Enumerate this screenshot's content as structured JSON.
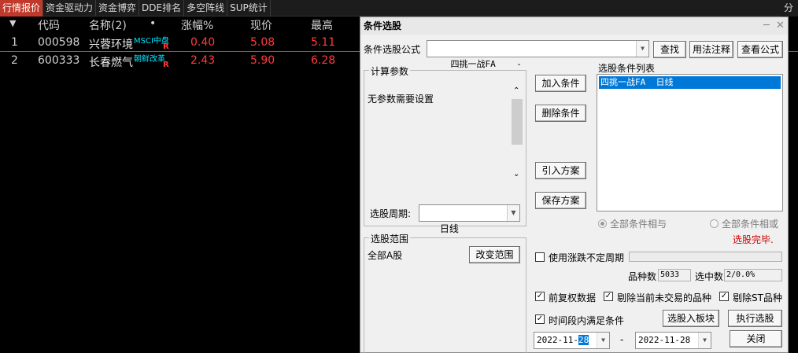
{
  "tabs": [
    "行情报价",
    "资金驱动力",
    "资金博弈",
    "DDE排名",
    "多空阵线",
    "SUP统计"
  ],
  "tab_right": "分",
  "table": {
    "headers": {
      "arrow": "▼",
      "code": "代码",
      "name": "名称(2)",
      "dot": "•",
      "change": "涨幅%",
      "price": "现价",
      "high": "最高"
    },
    "rows": [
      {
        "idx": "1",
        "code": "000598",
        "name": "兴蓉环境",
        "tag": "MSCI中盘",
        "flag": "R",
        "change": "0.40",
        "price": "5.08",
        "high": "5.11"
      },
      {
        "idx": "2",
        "code": "600333",
        "name": "长春燃气",
        "tag": "朝鲜改革",
        "flag": "R",
        "change": "2.43",
        "price": "5.90",
        "high": "6.28"
      }
    ]
  },
  "dialog": {
    "title": "条件选股",
    "minimize": "─",
    "close": "✕",
    "formula_label": "条件选股公式",
    "formula_value": "四挑一战FA    -",
    "buttons": {
      "find": "查找",
      "usage_note": "用法注释",
      "view_formula": "查看公式",
      "add_condition": "加入条件",
      "delete_condition": "删除条件",
      "import_plan": "引入方案",
      "save_plan": "保存方案",
      "change_range": "改变范围",
      "to_block": "选股入板块",
      "execute": "执行选股",
      "close": "关闭"
    },
    "params_group": "计算参数",
    "params_text": "无参数需要设置",
    "period_label": "选股周期:",
    "period_value": "日线",
    "condition_list_label": "选股条件列表",
    "condition_item": "四挑一战FA  日线",
    "radio_and": "全部条件相与",
    "radio_or": "全部条件相或",
    "status": "选股完毕.",
    "range_group": "选股范围",
    "range_value": "全部A股",
    "use_variable_period": "使用涨跌不定周期",
    "count_label": "品种数",
    "count_value": "5033",
    "selected_label": "选中数",
    "selected_value": "2/0.0%",
    "chk_adjust": "前复权数据",
    "chk_exclude_untraded": "剔除当前未交易的品种",
    "chk_exclude_st": "剔除ST品种",
    "chk_period_condition": "时间段内满足条件",
    "date_from_prefix": "2022-11-",
    "date_from_day": "28",
    "date_sep": "-",
    "date_to": "2022-11-28"
  },
  "colors": {
    "up_red": "#ff3b3b",
    "tag_cyan": "#00e5ff",
    "selection": "#0078d7",
    "status_red": "#d00000"
  }
}
